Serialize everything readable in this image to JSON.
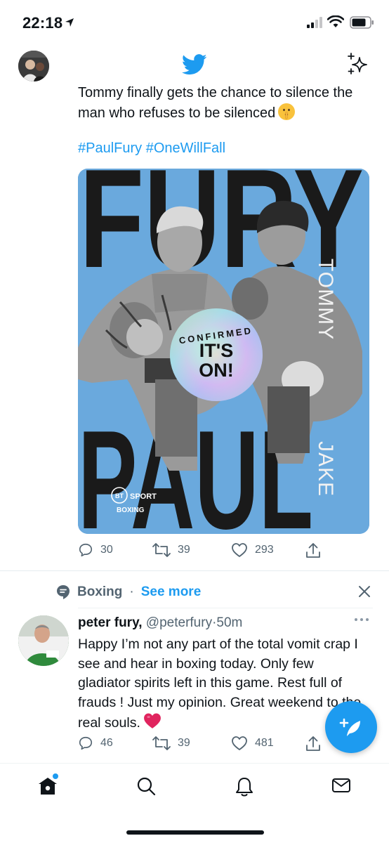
{
  "status_bar": {
    "time": "22:18"
  },
  "tweet1": {
    "text": "Tommy finally gets the chance to silence the man who refuses to be silenced",
    "hashtags": "#PaulFury #OneWillFall",
    "poster": {
      "top_word": "FURY",
      "bottom_word": "PAUL",
      "right_name_top": "TOMMY",
      "right_name_bottom": "JAKE",
      "badge_top": "CONFIRMED",
      "badge_line1": "IT'S",
      "badge_line2": "ON!",
      "brand_circle": "BT",
      "brand_sport": "SPORT",
      "brand_boxing": "BOXING"
    },
    "stats": {
      "replies": "30",
      "retweets": "39",
      "likes": "293"
    }
  },
  "topic": {
    "label": "Boxing",
    "separator": "·",
    "see_more": "See more"
  },
  "tweet2": {
    "name": "peter fury,",
    "handle": "@peterfury",
    "separator": "·",
    "time": "50m",
    "text": "Happy I’m not any part of the total vomit crap I see and hear in boxing today. Only few gladiator spirits left in this game. Rest full of frauds ! Just my opinion. Great weekend to the real souls.",
    "stats": {
      "replies": "46",
      "retweets": "39",
      "likes": "481"
    }
  },
  "colors": {
    "accent": "#1d9bf0",
    "muted": "#536471",
    "text": "#0f1419",
    "heart": "#e0245e",
    "poster_blue": "#6aa9dd"
  }
}
